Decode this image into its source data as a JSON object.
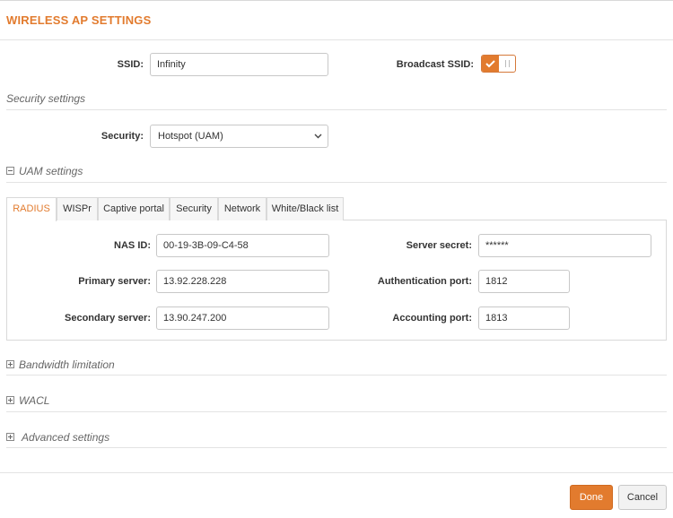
{
  "window": {
    "title": "WIRELESS AP SETTINGS"
  },
  "general": {
    "ssid_label": "SSID:",
    "ssid_value": "Infinity",
    "broadcast_label": "Broadcast SSID:",
    "broadcast_on": true
  },
  "security_settings": {
    "heading": "Security settings",
    "security_label": "Security:",
    "security_value": "Hotspot (UAM)"
  },
  "uam": {
    "heading": "UAM settings",
    "tabs": [
      {
        "label": "RADIUS",
        "active": true
      },
      {
        "label": "WISPr",
        "active": false
      },
      {
        "label": "Captive portal",
        "active": false
      },
      {
        "label": "Security",
        "active": false
      },
      {
        "label": "Network",
        "active": false
      },
      {
        "label": "White/Black list",
        "active": false
      }
    ],
    "radius": {
      "nas_id_label": "NAS ID:",
      "nas_id_value": "00-19-3B-09-C4-58",
      "primary_label": "Primary server:",
      "primary_value": "13.92.228.228",
      "secondary_label": "Secondary server:",
      "secondary_value": "13.90.247.200",
      "secret_label": "Server secret:",
      "secret_value": "******",
      "auth_port_label": "Authentication port:",
      "auth_port_value": "1812",
      "acct_port_label": "Accounting port:",
      "acct_port_value": "1813"
    }
  },
  "collapsed_sections": {
    "bandwidth": "Bandwidth limitation",
    "wacl": "WACL",
    "advanced": "Advanced settings"
  },
  "footer": {
    "done_label": "Done",
    "cancel_label": "Cancel"
  },
  "colors": {
    "accent": "#e27b2e",
    "border": "#d9d9d9",
    "section_text": "#666666"
  }
}
